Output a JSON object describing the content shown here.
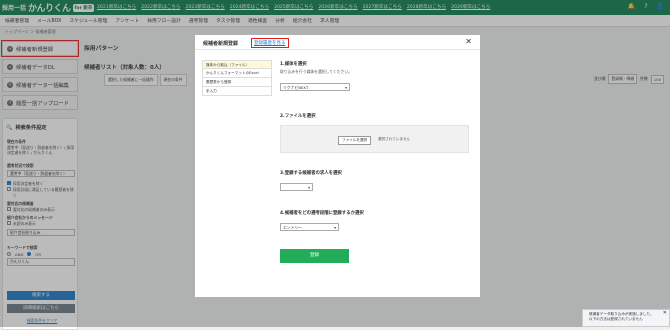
{
  "topbar": {
    "logo_prefix": "採用一括",
    "logo_main": "かんりくん",
    "logo_badge": "for 新卒",
    "links": [
      "2021新卒はこちら",
      "2022新卒はこちら",
      "2023新卒はこちら",
      "2024新卒はこちら",
      "2025新卒はこちら",
      "2026新卒はこちら",
      "2027新卒はこちら",
      "2028新卒はこちら",
      "2029新卒はこちら"
    ],
    "icons": [
      "bell-icon",
      "help-icon",
      "user-icon"
    ]
  },
  "nav": [
    "候補者管理",
    "メールBOX",
    "スケジュール管理",
    "アンケート",
    "採用フロー設計",
    "選考管理",
    "タスク管理",
    "適性検査",
    "分析",
    "紹介会社",
    "求人管理"
  ],
  "breadcrumb": "トップページ ＞ 候補者管理",
  "sidebar": {
    "buttons": [
      {
        "label": "候補者新規登録",
        "icon": "plus-icon"
      },
      {
        "label": "候補者データDL",
        "icon": "download-icon"
      },
      {
        "label": "候補者データ一括編集",
        "icon": "edit-icon"
      },
      {
        "label": "履歴一括アップロード",
        "icon": "upload-icon"
      }
    ],
    "search": {
      "title": "検索条件設定",
      "current_label": "現在の条件",
      "current_text": "選考中（見送り・辞退者を除く）/ 採用決定者を除く / かんりくん",
      "status_label": "選考状況で検索",
      "status_value": "選考中（見送り・辞退者を除く）",
      "exclude_hired": "採用決定者を除く",
      "exclude_duplicates": "採用計画に満足している履歴者を除く",
      "hide_required": "要対応の候補者",
      "hide_required_sub": "要対応の候補者のみ表示",
      "agent_message": "紹介会社からのメッセージ",
      "unread": "未読のみ表示",
      "agent_select": "紹介会社絞り込み",
      "keyword_label": "キーワードで検索",
      "and": "AND",
      "or": "OR",
      "keyword_value": "かんりくん",
      "search_button": "検索する",
      "detail_button": "詳細検索はこちら",
      "clear_link": "検索条件をクリア"
    }
  },
  "main": {
    "pattern_title": "採用パターン",
    "list_title": "候補者リスト（対象人数：0人）",
    "action_buttons": [
      "選択した候補者に一括操作",
      "現在の条件"
    ],
    "sort_label": "並び順",
    "sort_value": "登録順・降順",
    "count_label": "件数",
    "count_value": "100"
  },
  "modal": {
    "title": "候補者新規登録",
    "link": "登録履歴を見る",
    "close": "✕",
    "menu": [
      "媒体から取込（ファイル）",
      "かんりくんフォーマットのExcel",
      "履歴書から登録",
      "手入力"
    ],
    "s1_title": "1.媒体を選択",
    "s1_sub": "取り込みを行う媒体を選択してください。",
    "s1_value": "リクナビNEXT",
    "s2_title": "2.ファイルを選択",
    "file_button": "ファイルを選択",
    "file_none": "選択されていません",
    "s3_title": "3.登録する候補者の求人を選択",
    "s4_title": "4.候補者をどの選考段階に登録するか選択",
    "s4_value": "エントリー",
    "register": "登録"
  },
  "toast": {
    "line1": "候補者データ取り込みが実施しました。",
    "line2": "以下の方法は登録されていません"
  }
}
